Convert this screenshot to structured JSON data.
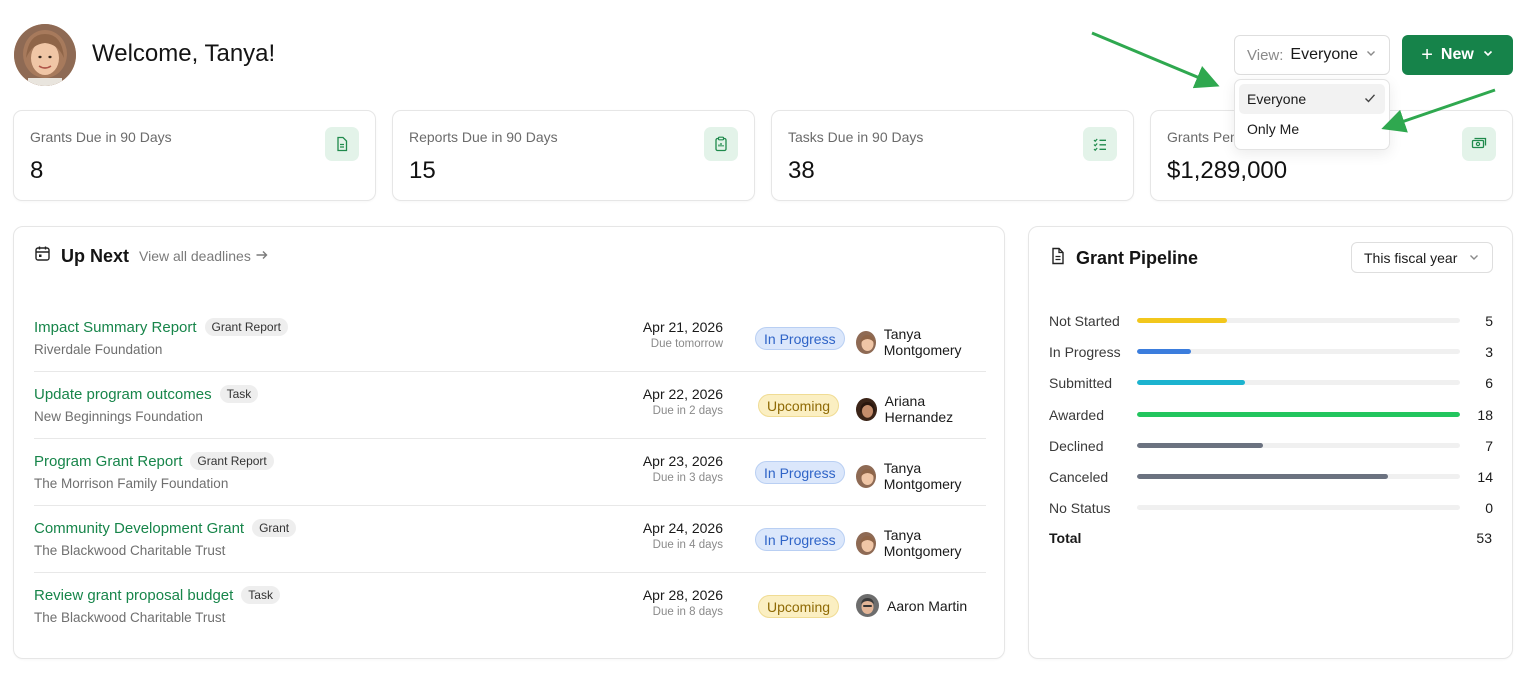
{
  "header": {
    "welcome": "Welcome, Tanya!",
    "view_label": "View:",
    "view_value": "Everyone",
    "new_label": "New",
    "dropdown": [
      {
        "label": "Everyone",
        "selected": true
      },
      {
        "label": "Only Me",
        "selected": false
      }
    ]
  },
  "stats": [
    {
      "title": "Grants Due in 90 Days",
      "value": "8",
      "icon": "document-icon"
    },
    {
      "title": "Reports Due in 90 Days",
      "value": "15",
      "icon": "clipboard-icon"
    },
    {
      "title": "Tasks Due in 90 Days",
      "value": "38",
      "icon": "checklist-icon"
    },
    {
      "title": "Grants Pen",
      "value": "$1,289,000",
      "icon": "money-icon"
    }
  ],
  "upnext": {
    "title": "Up Next",
    "link": "View all deadlines",
    "rows": [
      {
        "name": "Impact Summary Report",
        "tag": "Grant Report",
        "org": "Riverdale Foundation",
        "date": "Apr 21, 2026",
        "due": "Due tomorrow",
        "status": "In Progress",
        "person": "Tanya Montgomery"
      },
      {
        "name": "Update program outcomes",
        "tag": "Task",
        "org": "New Beginnings Foundation",
        "date": "Apr 22, 2026",
        "due": "Due in 2 days",
        "status": "Upcoming",
        "person": "Ariana Hernandez"
      },
      {
        "name": "Program Grant Report",
        "tag": "Grant Report",
        "org": "The Morrison Family Foundation",
        "date": "Apr 23, 2026",
        "due": "Due in 3 days",
        "status": "In Progress",
        "person": "Tanya Montgomery"
      },
      {
        "name": "Community Development Grant",
        "tag": "Grant",
        "org": "The Blackwood Charitable Trust",
        "date": "Apr 24, 2026",
        "due": "Due in 4 days",
        "status": "In Progress",
        "person": "Tanya Montgomery"
      },
      {
        "name": "Review grant proposal budget",
        "tag": "Task",
        "org": "The Blackwood Charitable Trust",
        "date": "Apr 28, 2026",
        "due": "Due in 8 days",
        "status": "Upcoming",
        "person": "Aaron Martin"
      }
    ]
  },
  "pipeline": {
    "title": "Grant Pipeline",
    "period": "This fiscal year",
    "max": 18,
    "items": [
      {
        "label": "Not Started",
        "count": 5,
        "color": "#f2c71c"
      },
      {
        "label": "In Progress",
        "count": 3,
        "color": "#3b7ddd"
      },
      {
        "label": "Submitted",
        "count": 6,
        "color": "#1cb3cf"
      },
      {
        "label": "Awarded",
        "count": 18,
        "color": "#22c55e"
      },
      {
        "label": "Declined",
        "count": 7,
        "color": "#6b7280"
      },
      {
        "label": "Canceled",
        "count": 14,
        "color": "#6b7280"
      },
      {
        "label": "No Status",
        "count": 0,
        "color": "#6b7280"
      }
    ],
    "total_label": "Total",
    "total": "53"
  },
  "colors": {
    "brand": "#16834a",
    "link_green": "#17854a",
    "annotation_arrow": "#2fa84f"
  }
}
